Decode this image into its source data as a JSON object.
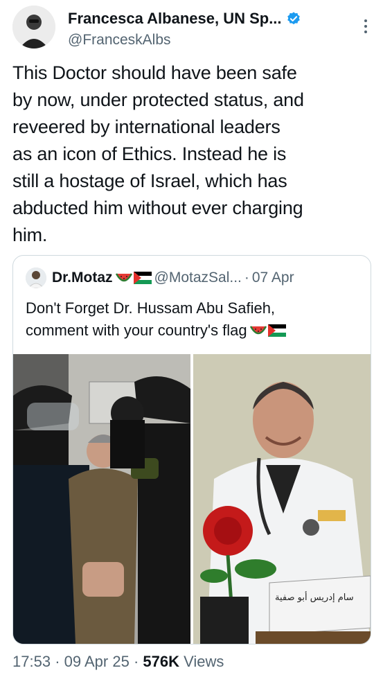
{
  "author": {
    "name": "Francesca Albanese, UN Sp...",
    "handle": "@FranceskAlbs"
  },
  "tweet": {
    "text": "This Doctor should have been safe\nby now, under protected status, and\nreveered by international leaders\nas an icon of Ethics. Instead he is\nstill a hostage of Israel, which has\nabducted him without ever charging\nhim."
  },
  "quote": {
    "name": "Dr.Motaz",
    "handle": "@MotazSal...",
    "separator": "·",
    "date": "07 Apr",
    "text": "Don't Forget Dr. Hussam Abu Safieh,\ncomment with your country's flag",
    "sign_text": "سام إدريس أبو صفية"
  },
  "footer": {
    "time": "17:53",
    "date": "09 Apr 25",
    "views_count": "576K",
    "views_label": "Views",
    "separator": "·"
  },
  "colors": {
    "verified": "#1d9bf0",
    "secondary_text": "#536471",
    "border": "#cfd9de"
  },
  "icons": [
    "verified-badge-icon",
    "more-options-icon",
    "watermelon-emoji-icon",
    "palestine-flag-icon"
  ]
}
